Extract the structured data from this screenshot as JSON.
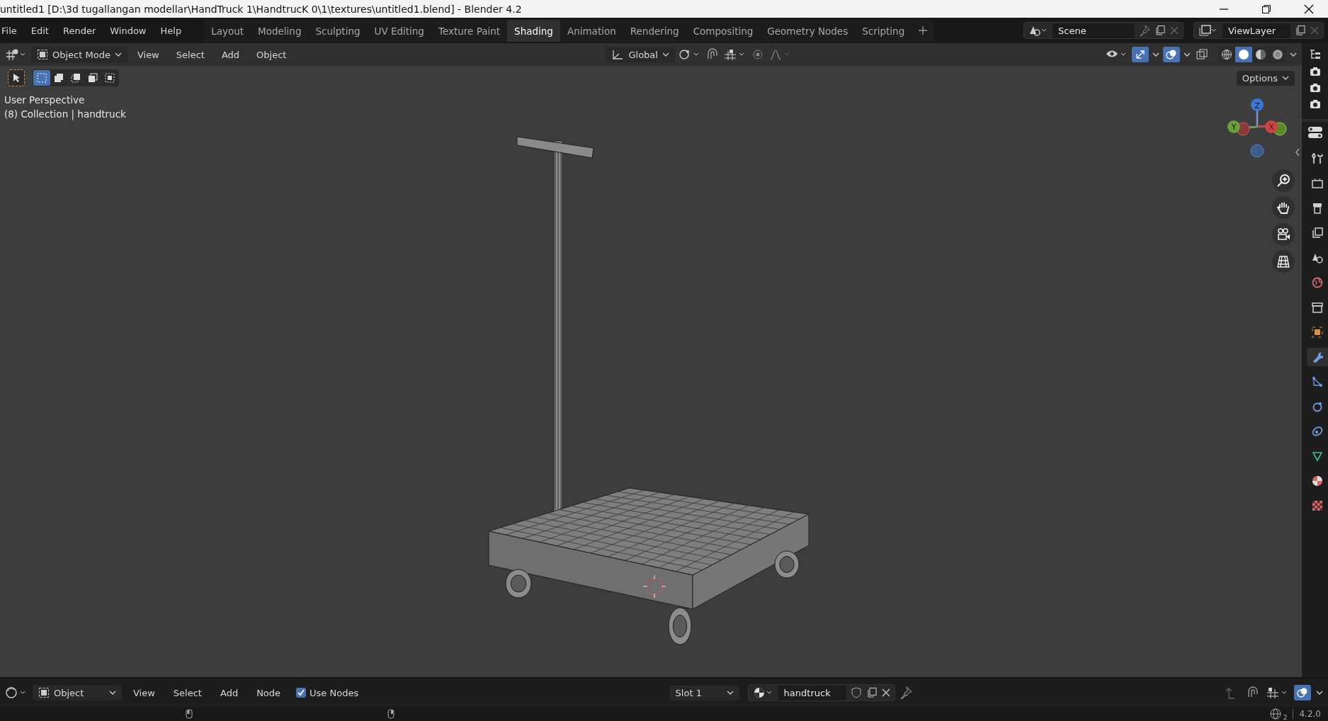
{
  "window": {
    "title": "untitled1 [D:\\3d tugallangan modellar\\HandTruck 1\\HandtrucK 0\\1\\textures\\untitled1.blend] - Blender 4.2"
  },
  "menu": [
    "File",
    "Edit",
    "Render",
    "Window",
    "Help"
  ],
  "workspaces": [
    {
      "label": "Layout",
      "selected": false
    },
    {
      "label": "Modeling",
      "selected": false
    },
    {
      "label": "Sculpting",
      "selected": false
    },
    {
      "label": "UV Editing",
      "selected": false
    },
    {
      "label": "Texture Paint",
      "selected": false
    },
    {
      "label": "Shading",
      "selected": true
    },
    {
      "label": "Animation",
      "selected": false
    },
    {
      "label": "Rendering",
      "selected": false
    },
    {
      "label": "Compositing",
      "selected": false
    },
    {
      "label": "Geometry Nodes",
      "selected": false
    },
    {
      "label": "Scripting",
      "selected": false
    }
  ],
  "scene": {
    "name": "Scene"
  },
  "view_layer": {
    "name": "ViewLayer"
  },
  "viewport": {
    "mode": "Object Mode",
    "menus": [
      "View",
      "Select",
      "Add",
      "Object"
    ],
    "orientation": "Global",
    "overlays": true,
    "gizmos": true,
    "shading": [
      {
        "kind": "wireframe",
        "selected": false
      },
      {
        "kind": "solid",
        "selected": true
      },
      {
        "kind": "material",
        "selected": false
      },
      {
        "kind": "rendered",
        "selected": false
      }
    ],
    "select_modes": [
      {
        "kind": "set",
        "selected": true
      },
      {
        "kind": "extend",
        "selected": false
      },
      {
        "kind": "subtract",
        "selected": false
      },
      {
        "kind": "invert",
        "selected": false
      },
      {
        "kind": "intersect",
        "selected": false
      }
    ],
    "options": "Options",
    "info": [
      "User Perspective",
      "(8) Collection | handtruck"
    ],
    "gizmo": {
      "z": "Z",
      "y": "Y",
      "x": "X"
    }
  },
  "properties_tabs": [
    {
      "kind": "tool",
      "selected": false
    },
    {
      "kind": "render",
      "selected": false
    },
    {
      "kind": "output",
      "selected": false
    },
    {
      "kind": "view_layer",
      "selected": false
    },
    {
      "kind": "scene",
      "selected": false
    },
    {
      "kind": "world",
      "selected": false
    },
    {
      "kind": "collection",
      "selected": false
    },
    {
      "kind": "object",
      "selected": false
    },
    {
      "kind": "modifiers",
      "selected": true
    },
    {
      "kind": "particles",
      "selected": false
    },
    {
      "kind": "physics",
      "selected": false
    },
    {
      "kind": "constraints",
      "selected": false
    },
    {
      "kind": "data",
      "selected": false
    },
    {
      "kind": "material",
      "selected": false
    },
    {
      "kind": "texture",
      "selected": false
    }
  ],
  "shader_editor": {
    "editor": "Object",
    "menus": [
      "View",
      "Select",
      "Add",
      "Node"
    ],
    "use_nodes": {
      "label": "Use Nodes",
      "checked": true
    },
    "slot": "Slot 1",
    "material": "handtruck"
  },
  "status_bar": {
    "count": "2",
    "version": "4.2.0"
  }
}
